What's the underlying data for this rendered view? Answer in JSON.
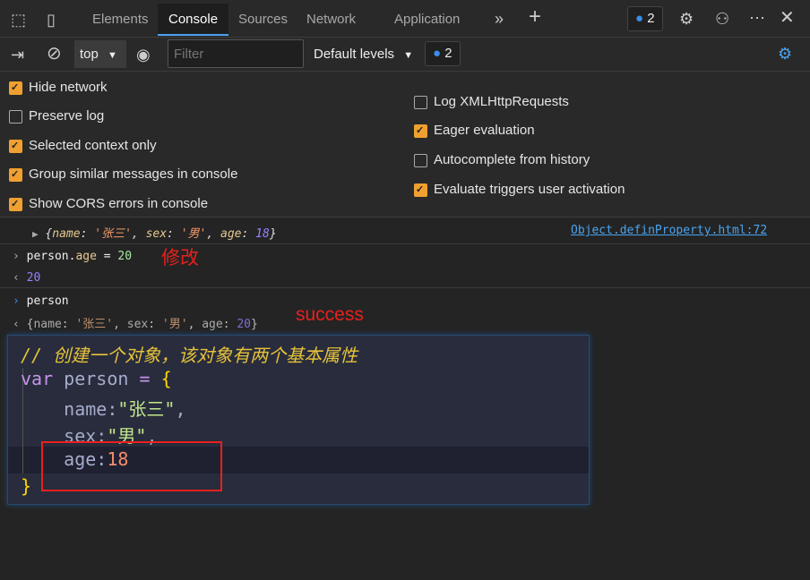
{
  "tabs": [
    {
      "label": "Elements"
    },
    {
      "label": "Console"
    },
    {
      "label": "Sources"
    },
    {
      "label": "Network"
    },
    {
      "label": "Application"
    }
  ],
  "header": {
    "issues_count": "2"
  },
  "toolbar": {
    "context": "top",
    "filter_placeholder": "Filter",
    "levels": "Default levels",
    "issues_count": "2"
  },
  "settings": {
    "left": [
      {
        "label": "Hide network",
        "checked": true
      },
      {
        "label": "Preserve log",
        "checked": false
      },
      {
        "label": "Selected context only",
        "checked": true
      },
      {
        "label": "Group similar messages in console",
        "checked": true
      },
      {
        "label": "Show CORS errors in console",
        "checked": true
      }
    ],
    "right": [
      {
        "label": "Log XMLHttpRequests",
        "checked": false
      },
      {
        "label": "Eager evaluation",
        "checked": true
      },
      {
        "label": "Autocomplete from history",
        "checked": false
      },
      {
        "label": "Evaluate triggers user activation",
        "checked": true
      }
    ]
  },
  "console": {
    "obj1": {
      "p1": "name",
      "v1": "'张三'",
      "p2": "sex",
      "v2": "'男'",
      "p3": "age",
      "v3": "18",
      "source": "Object.definProperty.html:72"
    },
    "cmd1": {
      "obj": "person.",
      "prop": "age",
      "eq": " = ",
      "val": "20",
      "note": "修改"
    },
    "res1": "20",
    "cmd2": "person",
    "obj2": {
      "p1": "name",
      "v1": "'张三'",
      "p2": "sex",
      "v2": "'男'",
      "p3": "age",
      "v3": "20",
      "note": "success"
    }
  },
  "code": {
    "comment": "// 创建一个对象，该对象有两个基本属性",
    "kw": "var",
    "name": "person",
    "eq": "=",
    "open": "{",
    "k1": "name:",
    "s1": "\"张三\"",
    "k2": "sex:",
    "s2": "\"男\"",
    "k3": "age:",
    "n3": "18",
    "close": "}"
  },
  "colors": {
    "accent": "#4aa3f0",
    "checkbox": "#f0a030",
    "annotation": "#e8201e"
  }
}
